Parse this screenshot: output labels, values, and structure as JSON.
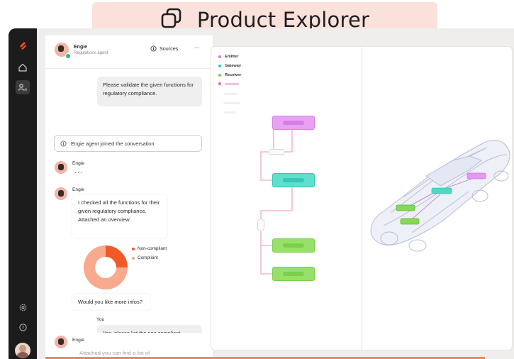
{
  "banner": {
    "title": "Product Explorer",
    "icon": "copy-icon"
  },
  "rail": {
    "icons": [
      "brand-logo-icon",
      "home-icon",
      "agent-ai-icon",
      "settings-icon",
      "help-icon",
      "user-avatar"
    ]
  },
  "chat": {
    "agent_name": "Engie",
    "agent_role": "Regulations agent",
    "sources_label": "Sources",
    "more_label": "···",
    "user_message_1": "Please validate the given functions for regulatory compliance.",
    "system_message": "Engie agent joined the conversation.",
    "typing_sender": "Engie",
    "typing_indicator": "·‧·",
    "reply_sender": "Engie",
    "reply_text": "I checked all the functions for their given regulatory compliance. Attached an overview:",
    "donut": {
      "legend": [
        {
          "label": "Non-compliant",
          "value": 0.25,
          "color": "#f05a28"
        },
        {
          "label": "Compliant",
          "value": 0.75,
          "color": "#f9a98e"
        }
      ]
    },
    "followup_question": "Would you like more infos?",
    "user_label": "You",
    "user_message_2": "Yes, please list the non compliant features and why they are not compliant",
    "last_sender": "Engie",
    "last_message_partial": "Attached you can find a list of"
  },
  "diagram": {
    "legend": [
      {
        "label": "Emitter",
        "color": "#d873e8"
      },
      {
        "label": "Gateway",
        "color": "#2ec9b5"
      },
      {
        "label": "Receiver",
        "color": "#76d04a"
      },
      {
        "label": "",
        "color": "#e468c9"
      }
    ],
    "node_colors": {
      "emitter": "#e7a2f2",
      "gateway": "#5fdfcc",
      "receiver": "#98e06a",
      "connector": "#f2a6cb"
    }
  }
}
